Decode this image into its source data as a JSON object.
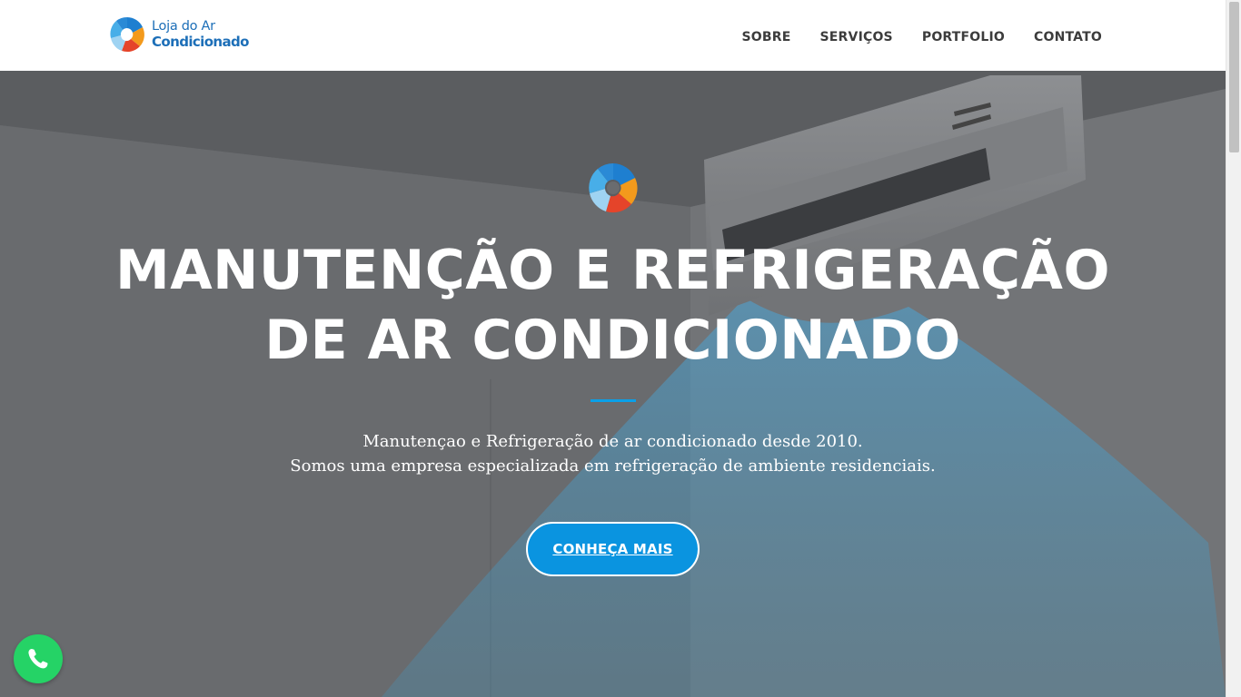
{
  "brand": {
    "line1": "Loja do Ar",
    "line2": "Condicionado",
    "icon": "swirl-logo-icon"
  },
  "nav": {
    "items": [
      {
        "label": "SOBRE"
      },
      {
        "label": "SERVIÇOS"
      },
      {
        "label": "PORTFOLIO"
      },
      {
        "label": "CONTATO"
      }
    ]
  },
  "hero": {
    "icon": "swirl-logo-icon",
    "title_line1": "MANUTENÇÃO E REFRIGERAÇÃO",
    "title_line2": "DE AR CONDICIONADO",
    "desc_line1": "Manutençao e Refrigeração de ar condicionado desde 2010.",
    "desc_line2": "Somos uma empresa especializada em refrigeração de ambiente residenciais.",
    "cta_label": "CONHEÇA MAIS"
  },
  "floating": {
    "whatsapp_icon": "whatsapp-icon"
  },
  "colors": {
    "accent": "#0a94e0",
    "brand_blue": "#1d6fb8",
    "divider": "#0aa0e8",
    "whatsapp_green": "#25d366",
    "nav_text": "#3c3c3c"
  }
}
